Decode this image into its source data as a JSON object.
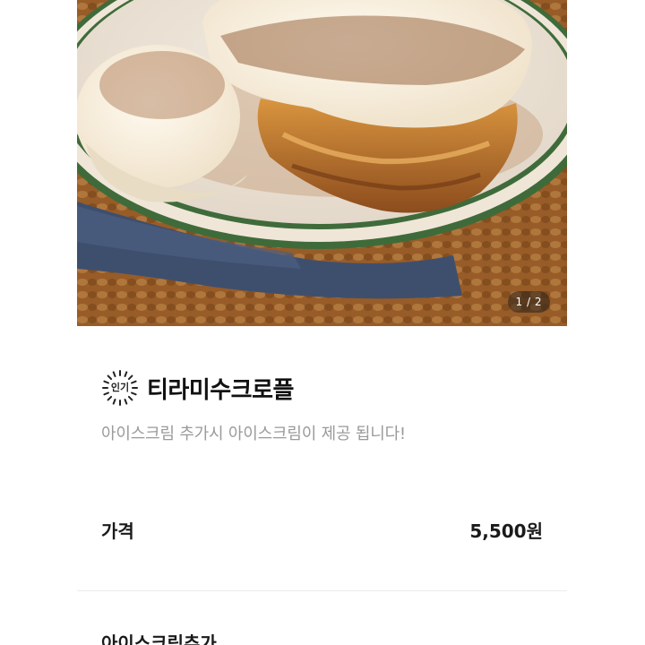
{
  "gallery": {
    "image_label": "tiramisu-croffle-photo",
    "pager_text": "1 / 2"
  },
  "product": {
    "badge_text": "인기",
    "name": "티라미수크로플",
    "description": "아이스크림 추가시 아이스크림이 제공 됩니다!"
  },
  "price": {
    "label": "가격",
    "value": "5,500원"
  },
  "options": {
    "section_title": "아이스크림추가"
  },
  "colors": {
    "text_primary": "#111111",
    "text_secondary": "#9a9a9a",
    "divider": "#ececec",
    "pager_bg": "#28201a"
  }
}
